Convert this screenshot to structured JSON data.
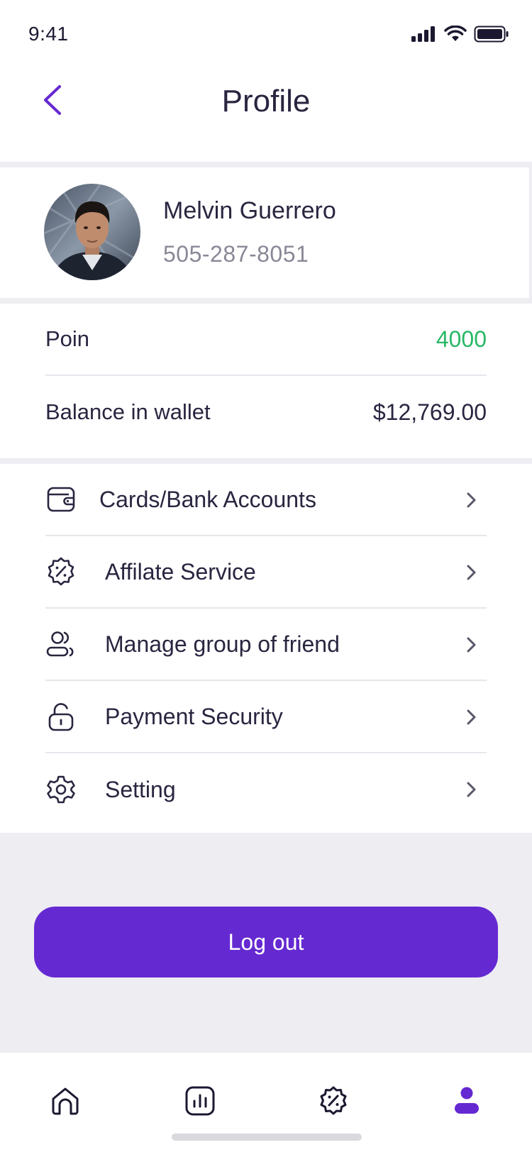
{
  "status_bar": {
    "time": "9:41",
    "icons": [
      "cellular-signal-icon",
      "wifi-icon",
      "battery-icon"
    ]
  },
  "header": {
    "title": "Profile",
    "back_icon": "chevron-left-icon"
  },
  "profile": {
    "name": "Melvin Guerrero",
    "phone": "505-287-8051"
  },
  "stats": {
    "points_label": "Poin",
    "points_value": "4000",
    "balance_label": "Balance in wallet",
    "balance_value": "$12,769.00"
  },
  "menu": {
    "items": [
      {
        "label": "Cards/Bank Accounts",
        "icon": "wallet-icon"
      },
      {
        "label": "Affilate Service",
        "icon": "discount-badge-icon"
      },
      {
        "label": "Manage group of friend",
        "icon": "users-icon"
      },
      {
        "label": "Payment Security",
        "icon": "unlock-icon"
      },
      {
        "label": "Setting",
        "icon": "gear-icon"
      }
    ]
  },
  "actions": {
    "logout_label": "Log out"
  },
  "tabbar": {
    "tabs": [
      {
        "icon": "home-icon",
        "active": false
      },
      {
        "icon": "chart-icon",
        "active": false
      },
      {
        "icon": "discount-badge-icon",
        "active": false
      },
      {
        "icon": "profile-icon",
        "active": true
      }
    ]
  },
  "colors": {
    "accent": "#6529d1",
    "points_green": "#27b865",
    "text_dark": "#2a2540",
    "text_muted": "#8b8796",
    "background": "#ededf2"
  }
}
